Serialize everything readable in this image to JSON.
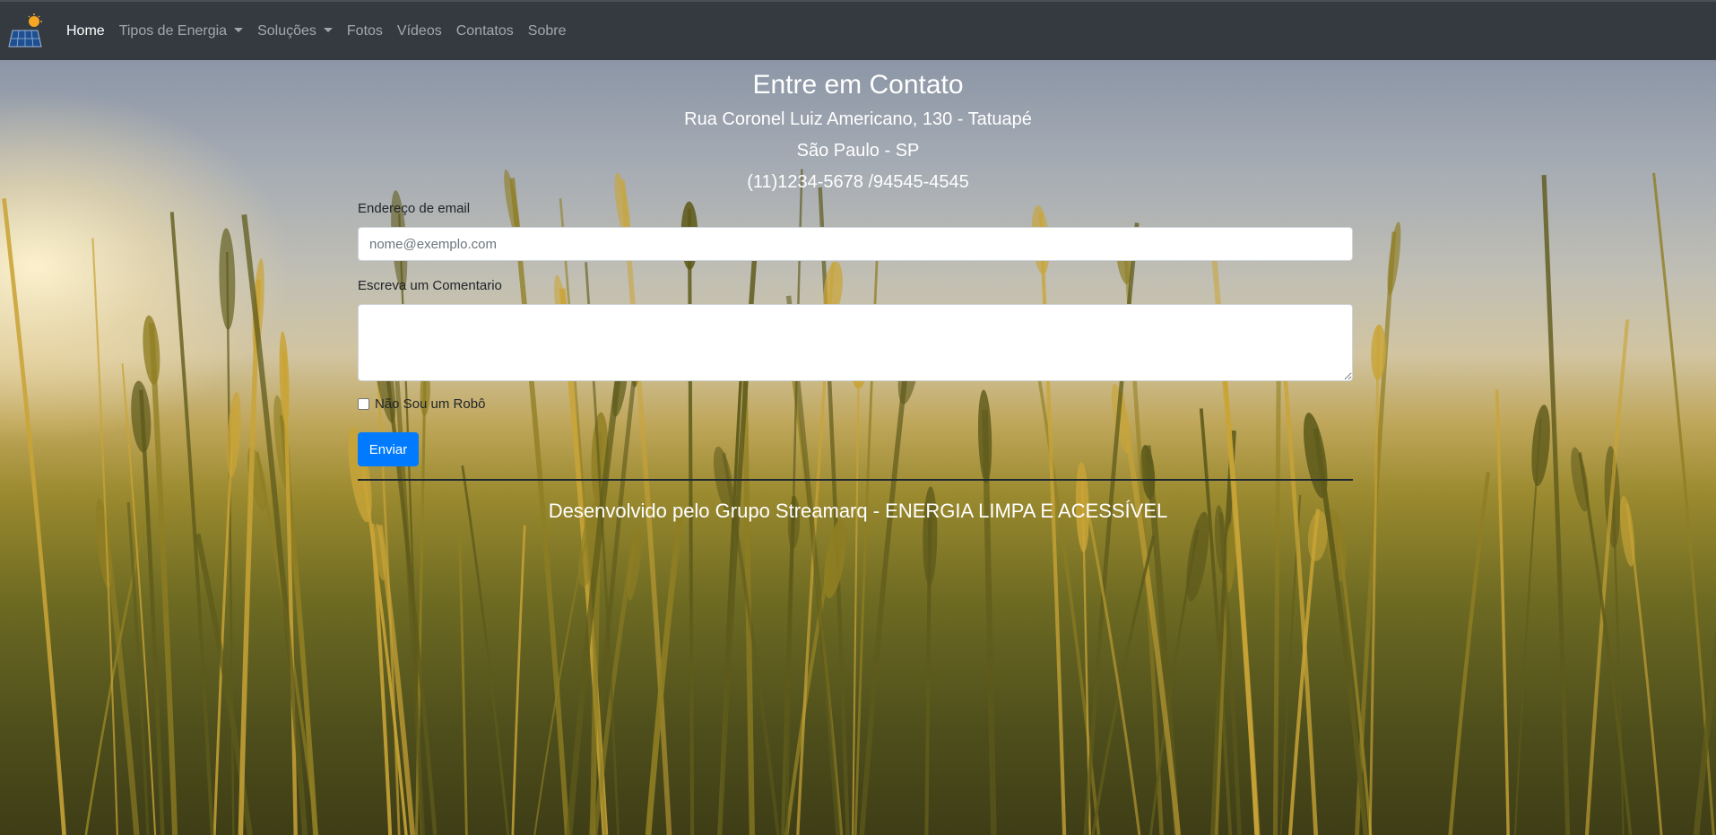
{
  "navbar": {
    "logo_icon": "solar-panel-sun-logo",
    "items": [
      {
        "label": "Home",
        "active": true,
        "dropdown": false
      },
      {
        "label": "Tipos de Energia",
        "active": false,
        "dropdown": true
      },
      {
        "label": "Soluções",
        "active": false,
        "dropdown": true
      },
      {
        "label": "Fotos",
        "active": false,
        "dropdown": false
      },
      {
        "label": "Vídeos",
        "active": false,
        "dropdown": false
      },
      {
        "label": "Contatos",
        "active": false,
        "dropdown": false
      },
      {
        "label": "Sobre",
        "active": false,
        "dropdown": false
      }
    ]
  },
  "contact": {
    "title": "Entre em Contato",
    "address": "Rua Coronel Luiz Americano, 130 - Tatuapé",
    "city": "São Paulo - SP",
    "phone": "(11)1234-5678 /94545-4545"
  },
  "form": {
    "email_label": "Endereço de email",
    "email_placeholder": "nome@exemplo.com",
    "email_value": "",
    "comment_label": "Escreva um Comentario",
    "comment_value": "",
    "robot_label": "Não Sou um Robô",
    "robot_checked": false,
    "submit_label": "Enviar"
  },
  "footer": {
    "text": "Desenvolvido pelo Grupo Streamarq - ENERGIA LIMPA E ACESSÍVEL"
  },
  "colors": {
    "navbar_bg": "#343a40",
    "primary_button": "#007bff",
    "text_light": "#ffffff",
    "text_dark": "#212529"
  }
}
